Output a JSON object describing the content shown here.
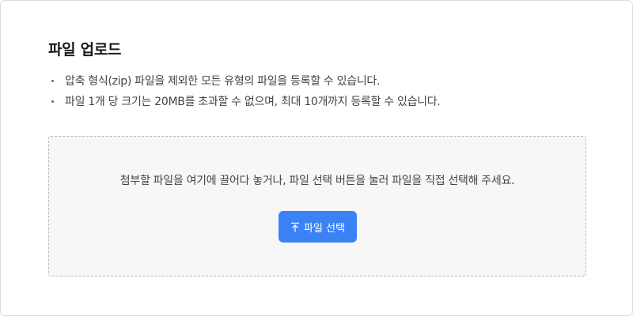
{
  "upload": {
    "title": "파일 업로드",
    "guides": [
      "압축 형식(zip) 파일을 제외한 모든 유형의 파일을 등록할 수 있습니다.",
      "파일 1개 당 크기는 20MB를 초과할 수 없으며, 최대 10개까지 등록할 수 있습니다."
    ],
    "dropzone": {
      "message": "첨부할 파일을 여기에 끌어다 놓거나, 파일 선택 버튼을 눌러 파일을 직접 선택해 주세요.",
      "button_label": "파일 선택",
      "button_icon": "upload-icon"
    }
  },
  "colors": {
    "accent": "#3b82f6",
    "dropzone_bg": "#f7f7f7",
    "dropzone_border": "#b9b9b9"
  }
}
